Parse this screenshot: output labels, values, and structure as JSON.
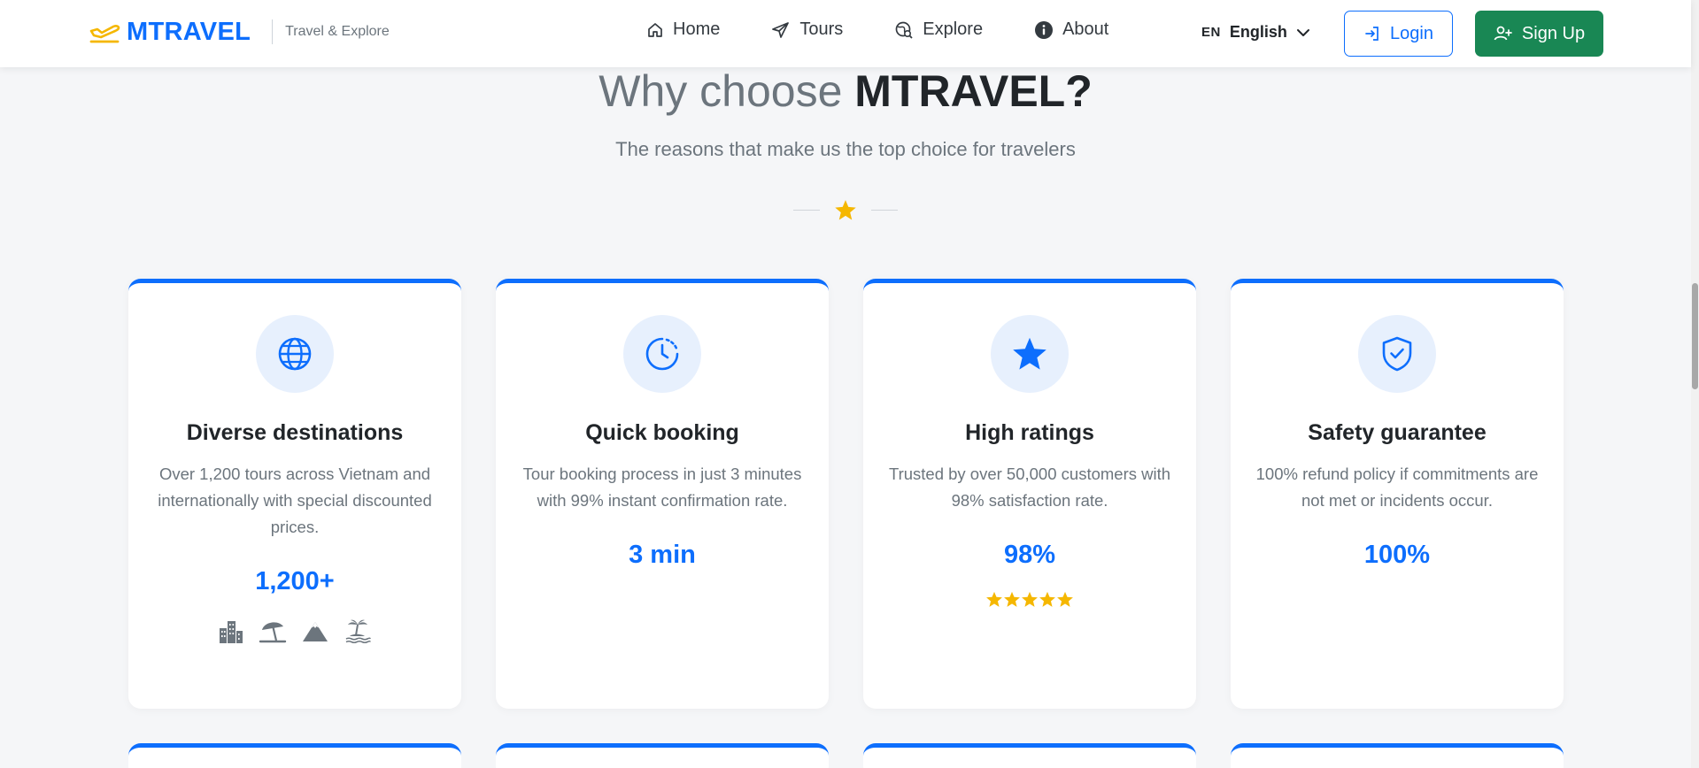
{
  "navbar": {
    "brand_name": "MTRAVEL",
    "tagline": "Travel & Explore",
    "links": [
      {
        "label": "Home",
        "icon": "home-icon"
      },
      {
        "label": "Tours",
        "icon": "paper-plane-icon"
      },
      {
        "label": "Explore",
        "icon": "globe-search-icon"
      },
      {
        "label": "About",
        "icon": "info-icon"
      }
    ],
    "language": {
      "code": "EN",
      "name": "English"
    },
    "login_label": "Login",
    "signup_label": "Sign Up"
  },
  "section": {
    "title_prefix": "Why choose ",
    "title_brand": "MTRAVEL?",
    "subtitle": "The reasons that make us the top choice for travelers"
  },
  "cards": [
    {
      "icon": "globe-icon",
      "title": "Diverse destinations",
      "description": "Over 1,200 tours across Vietnam and internationally with special discounted prices.",
      "stat": "1,200+",
      "extra_icons": [
        "city-icon",
        "beach-umbrella-icon",
        "mountain-icon",
        "island-icon"
      ]
    },
    {
      "icon": "clock-icon",
      "title": "Quick booking",
      "description": "Tour booking process in just 3 minutes with 99% instant confirmation rate.",
      "stat": "3 min"
    },
    {
      "icon": "star-icon",
      "title": "High ratings",
      "description": "Trusted by over 50,000 customers with 98% satisfaction rate.",
      "stat": "98%",
      "rating_stars": 5
    },
    {
      "icon": "shield-check-icon",
      "title": "Safety guarantee",
      "description": "100% refund policy if commitments are not met or incidents occur.",
      "stat": "100%"
    }
  ],
  "colors": {
    "primary": "#0d6efd",
    "success": "#198754",
    "accent_star": "#f5b700",
    "background": "#f5f6f8"
  }
}
